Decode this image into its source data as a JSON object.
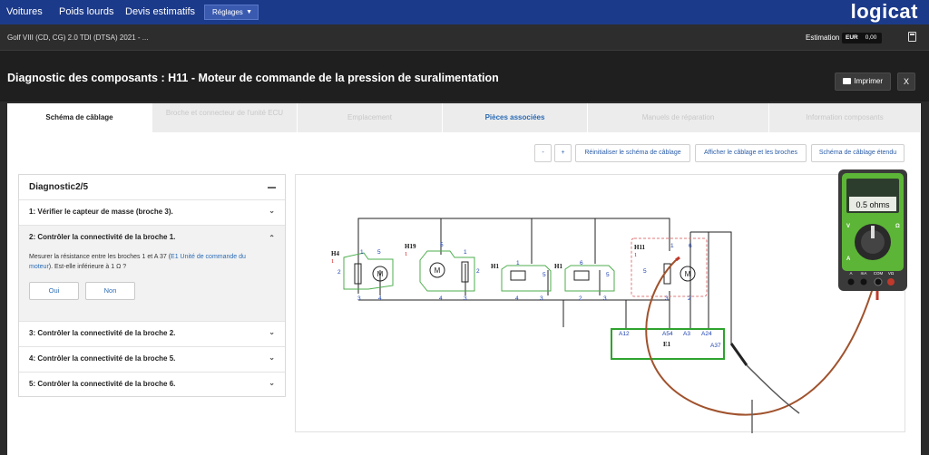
{
  "nav": {
    "items": [
      "Voitures",
      "Poids lourds",
      "Devis estimatifs"
    ],
    "settings": "Réglages",
    "logo": "logicat"
  },
  "vehicle": {
    "label": "Golf VIII (CD, CG) 2.0 TDI (DTSA) 2021 - ...",
    "estimation_label": "Estimation",
    "currency": "EUR",
    "amount": "0,00"
  },
  "page": {
    "title": "Diagnostic des composants : H11 - Moteur de commande de la pression de suralimentation",
    "print_label": "Imprimer",
    "close_label": "X"
  },
  "tabs": [
    {
      "label": "Schéma de câblage",
      "state": "active"
    },
    {
      "label": "Broche et connecteur de l'unité ECU",
      "state": "disabled"
    },
    {
      "label": "Emplacement",
      "state": "disabled"
    },
    {
      "label": "Pièces associées",
      "state": "link"
    },
    {
      "label": "Manuels de réparation",
      "state": "disabled"
    },
    {
      "label": "Information composants",
      "state": "disabled"
    }
  ],
  "toolbar": {
    "zoom_out": "-",
    "zoom_in": "+",
    "reset": "Réinitialiser le schéma de câblage",
    "show_pins": "Afficher le câblage et les broches",
    "extended": "Schéma de câblage étendu"
  },
  "diagnostic": {
    "title": "Diagnostic2/5",
    "steps": [
      {
        "label": "1: Vérifier le capteur de masse (broche 3)."
      },
      {
        "label": "2: Contrôler la connectivité de la broche 1.",
        "desc_before": "Mesurer la résistance entre les broches 1 et A 37 (",
        "desc_link": "E1 Unité de commande du moteur",
        "desc_after": "). Est-elle inférieure à 1 Ω ?",
        "yes": "Oui",
        "no": "Non"
      },
      {
        "label": "3: Contrôler la connectivité de la broche 2."
      },
      {
        "label": "4: Contrôler la connectivité de la broche 5."
      },
      {
        "label": "5: Contrôler la connectivité de la broche 6."
      }
    ]
  },
  "schematic": {
    "components": {
      "h4": "H4",
      "h19": "H19",
      "h1a": "H1",
      "h1b": "H1",
      "h11": "H11",
      "e1": "E1"
    },
    "pins": {
      "h4_1": "1",
      "h4_1r": "1",
      "h4_2": "2",
      "h4_5": "5",
      "h4_3": "3",
      "h4_4": "4",
      "h19_1r": "1",
      "h19_5": "5",
      "h19_1": "1",
      "h19_2": "2",
      "h19_4": "4",
      "h19_3": "3",
      "h1a_1": "1",
      "h1a_5": "5",
      "h1a_4": "4",
      "h1a_3": "3",
      "h1b_1": "1",
      "h1b_6": "6",
      "h1b_5": "5",
      "h1b_2": "2",
      "h1b_3": "3",
      "h11_1r": "1",
      "h11_1": "1",
      "h11_6": "6",
      "h11_5": "5",
      "h11_3": "3",
      "h11_2": "2",
      "e1_a12": "A12",
      "e1_a54": "A54",
      "e1_a3": "A3",
      "e1_a24": "A24",
      "e1_a37": "A37"
    },
    "motor_symbol": "M"
  },
  "multimeter": {
    "reading": "0.5 ohms",
    "dial_labels": [
      "V",
      "Ω",
      "A"
    ],
    "jacks": [
      "A",
      "mA",
      "COM",
      "VΩ"
    ],
    "colors": {
      "body": "#5cb536",
      "probe_red": "#c0392b",
      "probe_black": "#222222",
      "lead": "#a0522d"
    }
  },
  "colors": {
    "nav": "#1c3a8a",
    "accent": "#2a6bb5",
    "connector_outline": "#4cae4c",
    "h11_highlight": "#e07a7a",
    "e1_box": "#2ea32e"
  }
}
